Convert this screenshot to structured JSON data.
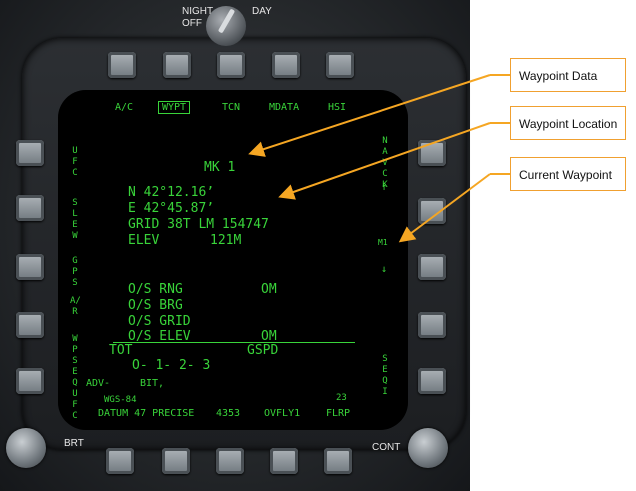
{
  "panel": {
    "night_day_label": "NIGHT",
    "day_label": "DAY",
    "off_label": "OFF",
    "brt_label": "BRT",
    "cont_label": "CONT"
  },
  "top_menu": [
    "A/C",
    "WYPT",
    "TCN",
    "MDATA",
    "HSI"
  ],
  "left_osb_labels": [
    "UFC",
    "SLEW",
    "GPS",
    "A/R",
    "WP SEQ UFC"
  ],
  "right_osb_labels": {
    "navck": "NAV CK",
    "up_arrow": "↑",
    "waypoint": "M1",
    "down_arrow": "↓",
    "seqi": "SEQI"
  },
  "waypoint": {
    "title": "MK 1",
    "lat": "N 42°12.16’",
    "lon": "E 42°45.87’",
    "grid": "GRID 38T LM 154747",
    "elev_label": "ELEV",
    "elev_value": "121M"
  },
  "offset": {
    "rng": "O/S RNG",
    "rng_val": "OM",
    "brg": "O/S BRG",
    "grid": "O/S GRID",
    "elev": "O/S ELEV",
    "elev_val": "OM"
  },
  "tot": {
    "label": "TOT",
    "gspd": "GSPD",
    "seq": "O- 1- 2- 3"
  },
  "bottom": {
    "adv": "ADV-",
    "bit": "BIT,",
    "wgs": "WGS-84",
    "datum": "DATUM 47 PRECISE",
    "num": "4353",
    "ovfly": "OVFLY1",
    "flrp": "FLRP",
    "small_num": "23"
  },
  "callouts": {
    "waypoint_data": "Waypoint Data",
    "waypoint_location": "Waypoint Location",
    "current_waypoint": "Current Waypoint"
  },
  "colors": {
    "display_green": "#39d43a",
    "callout_border": "#f0a030",
    "arrow": "#f5a623"
  }
}
